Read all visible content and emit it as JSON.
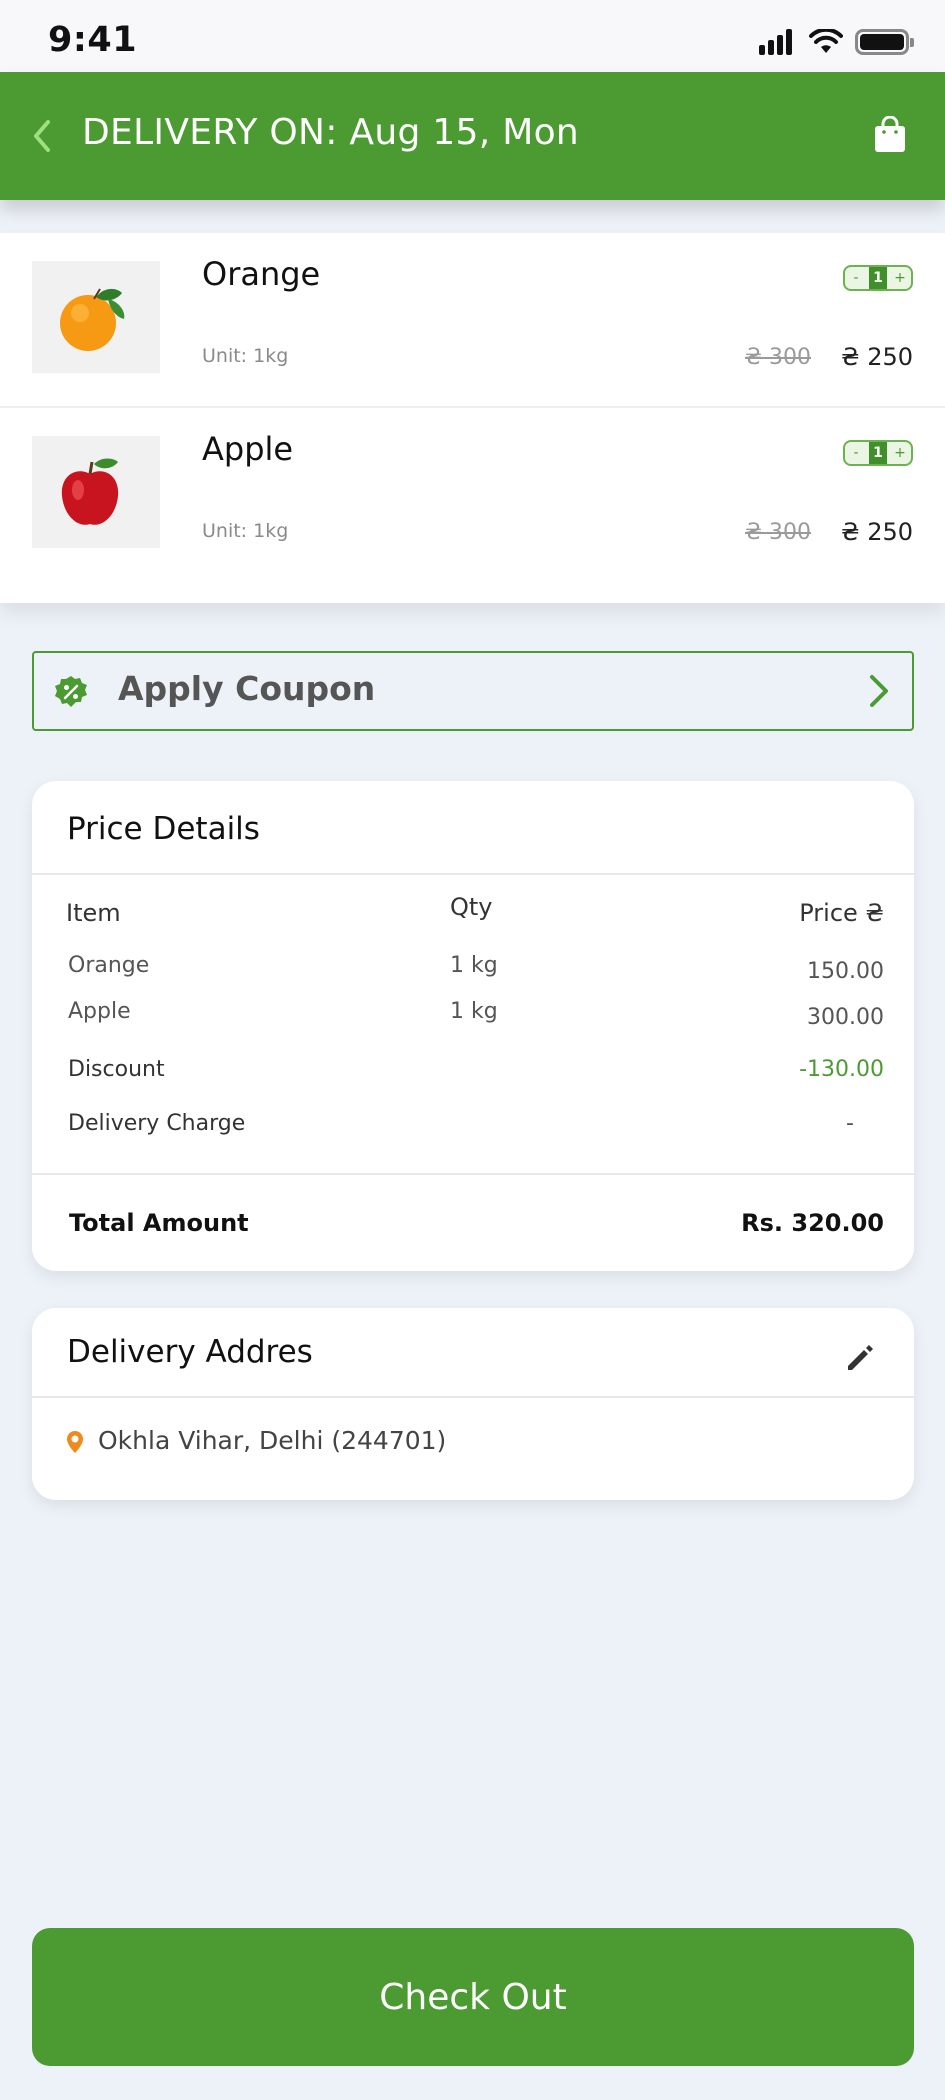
{
  "status_bar": {
    "time": "9:41"
  },
  "header": {
    "title": "DELIVERY ON: Aug 15, Mon"
  },
  "cart": {
    "items": [
      {
        "name": "Orange",
        "unit": "Unit: 1kg",
        "qty": "1",
        "minus": "-",
        "plus": "+",
        "old_price": "₴ 300",
        "price": "₴ 250",
        "thumb_icon": "orange-fruit-icon"
      },
      {
        "name": "Apple",
        "unit": "Unit: 1kg",
        "qty": "1",
        "minus": "-",
        "plus": "+",
        "old_price": "₴ 300",
        "price": "₴ 250",
        "thumb_icon": "apple-fruit-icon"
      }
    ]
  },
  "coupon": {
    "label": "Apply Coupon",
    "icon": "percent-badge-icon"
  },
  "price_details": {
    "title": "Price Details",
    "headers": {
      "item": "Item",
      "qty": "Qty",
      "price": "Price ₴"
    },
    "rows": [
      {
        "item": "Orange",
        "qty": "1 kg",
        "price": "150.00"
      },
      {
        "item": "Apple",
        "qty": "1 kg",
        "price": "300.00"
      }
    ],
    "discount_label": "Discount",
    "discount_value": "-130.00",
    "delivery_label": "Delivery Charge",
    "delivery_value": "-",
    "total_label": "Total Amount",
    "total_value": "Rs. 320.00"
  },
  "address": {
    "title": "Delivery Addres",
    "text": "Okhla Vihar, Delhi (244701)"
  },
  "checkout": {
    "label": "Check Out"
  },
  "colors": {
    "brand_green": "#4b9b32",
    "background": "#edf2f8",
    "pin_orange": "#f08a1c"
  }
}
